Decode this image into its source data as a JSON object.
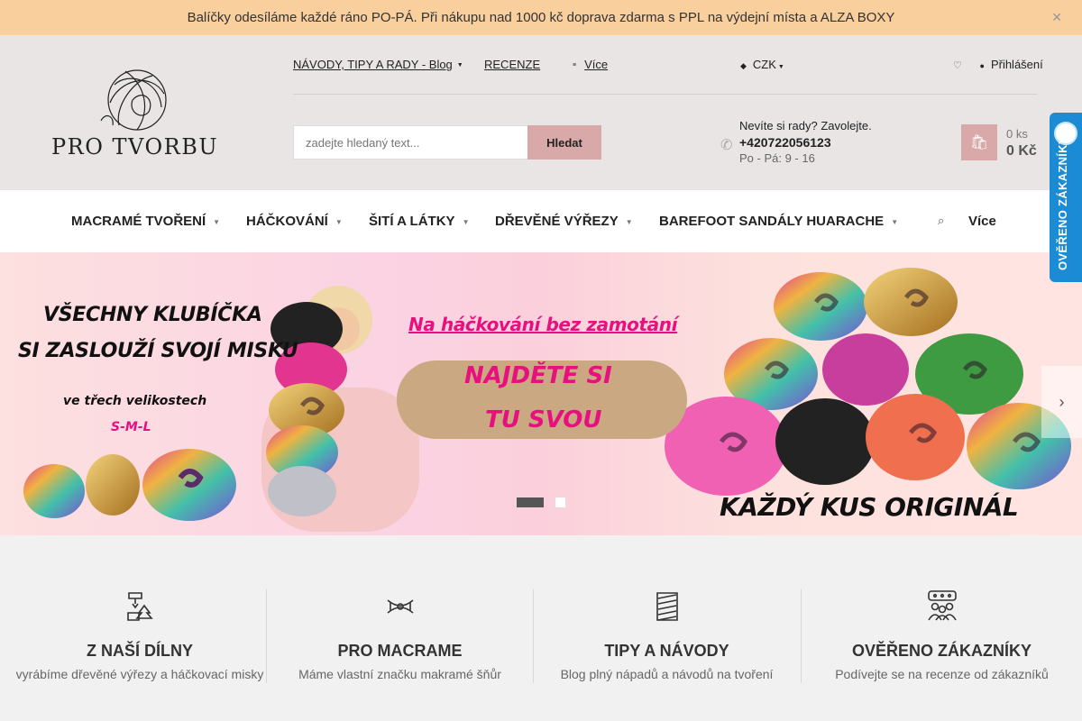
{
  "announcement": {
    "text": "Balíčky odesíláme každé ráno PO-PÁ. Při nákupu nad 1000 kč doprava zdarma s PPL na výdejní místa a ALZA BOXY",
    "close_icon": "close-icon"
  },
  "logo": {
    "text": "PRO TVORBU"
  },
  "toplinks": [
    {
      "label": "NÁVODY, TIPY A RADY - Blog"
    },
    {
      "label": "RECENZE"
    },
    {
      "label": "Více"
    }
  ],
  "currency": {
    "label": "CZK"
  },
  "user": {
    "login_label": "Přihlášení"
  },
  "search": {
    "placeholder": "zadejte hledaný text...",
    "button_label": "Hledat"
  },
  "contact": {
    "question": "Nevíte si rady? Zavolejte.",
    "phone": "+420722056123",
    "hours": "Po - Pá: 9 - 16"
  },
  "cart": {
    "count": "0 ks",
    "total": "0 Kč"
  },
  "nav": {
    "items": [
      {
        "label": "MACRAMÉ TVOŘENÍ"
      },
      {
        "label": "HÁČKOVÁNÍ"
      },
      {
        "label": "ŠITÍ A LÁTKY"
      },
      {
        "label": "DŘEVĚNÉ VÝŘEZY"
      },
      {
        "label": "BAREFOOT SANDÁLY HUARACHE"
      }
    ],
    "more_label": "Více"
  },
  "banner": {
    "title_line1": "VŠECHNY KLUBÍČKA",
    "title_line2": "SI ZASLOUŽÍ SVOJÍ MISKU",
    "subtitle": "ve třech velikostech",
    "sizes": "S-M-L",
    "tagline": "Na háčkování bez zamotání",
    "cta_line1": "NAJDĚTE SI",
    "cta_line2": "TU SVOU",
    "footer": "KAŽDÝ KUS ORIGINÁL",
    "active_slide": 1,
    "slide_count": 2
  },
  "badge": {
    "label": "OVĚŘENO ZÁKAZNÍKY"
  },
  "features": [
    {
      "icon": "workshop-icon",
      "title": "Z NAŠÍ DÍLNY",
      "desc": "vyrábíme dřevěné výřezy a háčkovací misky"
    },
    {
      "icon": "macrame-icon",
      "title": "PRO MACRAME",
      "desc": "Máme vlastní značku makramé šňůr"
    },
    {
      "icon": "yarn-icon",
      "title": "TIPY A NÁVODY",
      "desc": "Blog plný nápadů a návodů na tvoření"
    },
    {
      "icon": "customers-icon",
      "title": "OVĚŘENO ZÁKAZNÍKY",
      "desc": "Podívejte se na recenze od zákazníků"
    }
  ],
  "colors": {
    "announcement_bg": "#f8cf9d",
    "header_bg": "#e9e5e5",
    "accent_pink": "#d9a9a9",
    "banner_magenta": "#e8107e",
    "badge_blue": "#1b8bd6"
  }
}
